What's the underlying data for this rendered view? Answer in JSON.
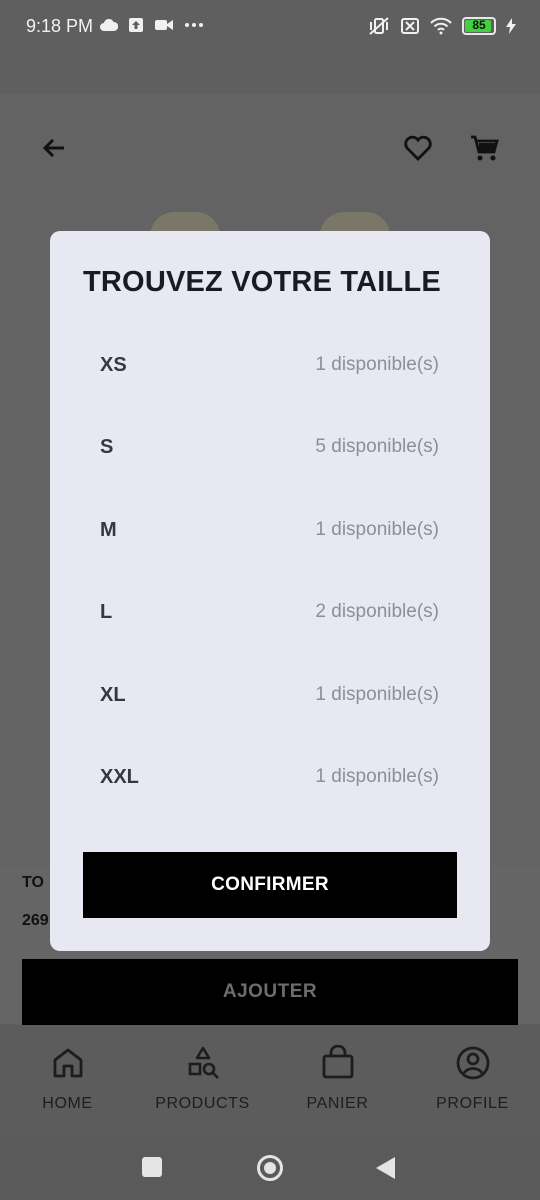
{
  "status_bar": {
    "time": "9:18 PM",
    "battery_level": "85",
    "left_icons": [
      "cloud-icon",
      "upload-icon",
      "video-icon",
      "more-dots-icon"
    ],
    "right_icons": [
      "vibrate-off-icon",
      "sim-off-icon",
      "wifi-icon",
      "battery-icon",
      "charging-icon"
    ]
  },
  "header": {
    "icons": [
      "back-arrow-icon",
      "heart-icon",
      "cart-icon"
    ]
  },
  "product": {
    "name_partial": "TO",
    "price_partial": "269",
    "add_button_label": "AJOUTER"
  },
  "modal": {
    "title": "TROUVEZ VOTRE TAILLE",
    "sizes": [
      {
        "size": "XS",
        "availability": "1 disponible(s)"
      },
      {
        "size": "S",
        "availability": "5 disponible(s)"
      },
      {
        "size": "M",
        "availability": "1 disponible(s)"
      },
      {
        "size": "L",
        "availability": "2 disponible(s)"
      },
      {
        "size": "XL",
        "availability": "1 disponible(s)"
      },
      {
        "size": "XXL",
        "availability": "1 disponible(s)"
      }
    ],
    "confirm_label": "CONFIRMER"
  },
  "bottom_nav": {
    "items": [
      {
        "label": "HOME",
        "icon": "home-icon"
      },
      {
        "label": "PRODUCTS",
        "icon": "products-icon"
      },
      {
        "label": "PANIER",
        "icon": "shopping-bag-icon"
      },
      {
        "label": "PROFILE",
        "icon": "profile-icon"
      }
    ]
  },
  "colors": {
    "modal_background": "#e8e8f3",
    "button_background": "#000000",
    "scrim": "#5f5f5f",
    "battery_fill": "#3fd13f"
  }
}
